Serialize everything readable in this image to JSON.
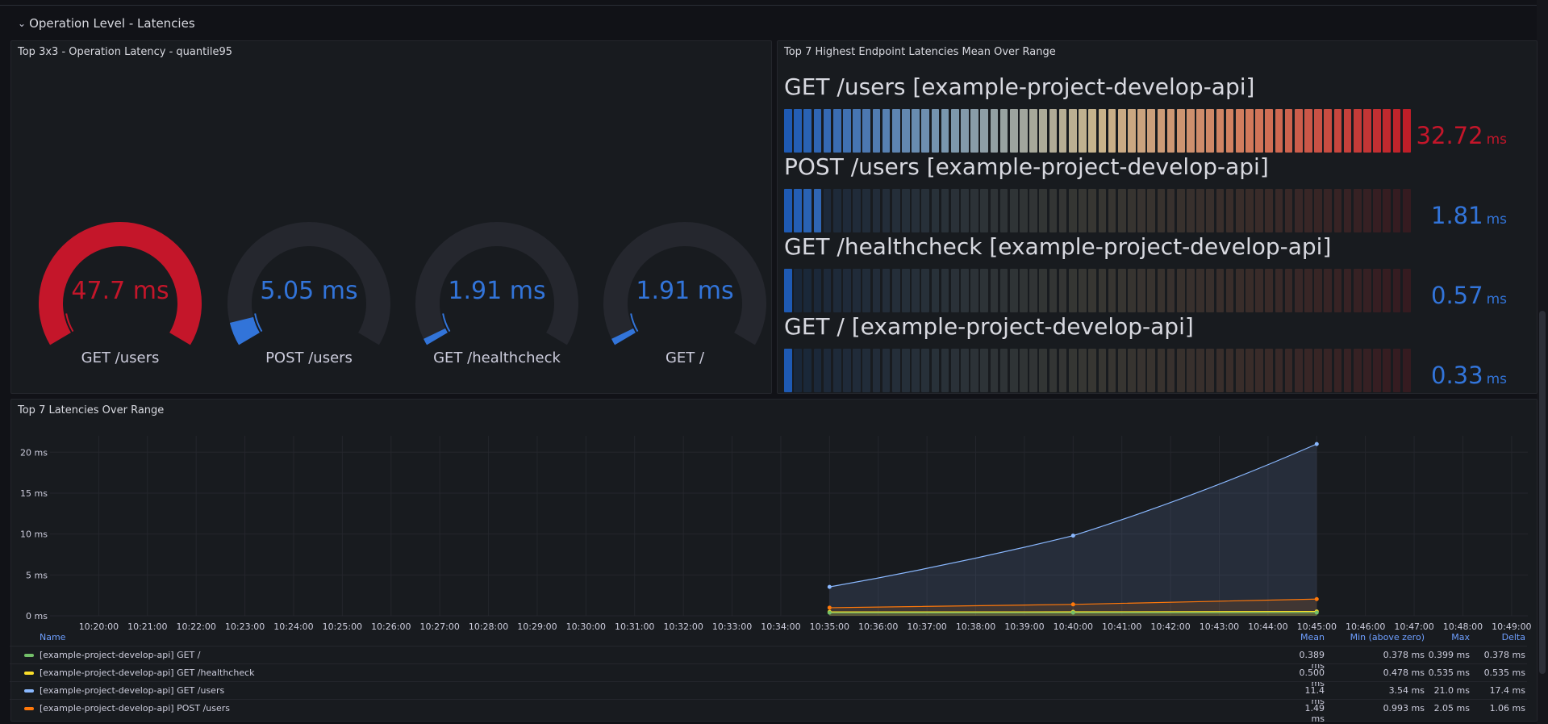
{
  "row": {
    "chevron": "⌄",
    "title": "Operation Level - Latencies"
  },
  "gauge_panel": {
    "title": "Top 3x3 - Operation Latency - quantile95",
    "gauges": [
      {
        "value": "47.7 ms",
        "label": "GET /users",
        "fraction": 1.0,
        "color": "#c4162a"
      },
      {
        "value": "5.05 ms",
        "label": "POST /users",
        "fraction": 0.07,
        "color": "#3274d9"
      },
      {
        "value": "1.91 ms",
        "label": "GET /healthcheck",
        "fraction": 0.02,
        "color": "#3274d9"
      },
      {
        "value": "1.91 ms",
        "label": "GET /",
        "fraction": 0.02,
        "color": "#3274d9"
      }
    ]
  },
  "bar_panel": {
    "title": "Top 7 Highest Endpoint Latencies Mean Over Range",
    "rows": [
      {
        "label": "GET /users [example-project-develop-api]",
        "value": "32.72",
        "unit": "ms",
        "fraction": 1.0,
        "color": "#c4162a"
      },
      {
        "label": "POST /users [example-project-develop-api]",
        "value": "1.81",
        "unit": "ms",
        "fraction": 0.055,
        "color": "#3274d9"
      },
      {
        "label": "GET /healthcheck [example-project-develop-api]",
        "value": "0.57",
        "unit": "ms",
        "fraction": 0.017,
        "color": "#3274d9"
      },
      {
        "label": "GET / [example-project-develop-api]",
        "value": "0.33",
        "unit": "ms",
        "fraction": 0.01,
        "color": "#3274d9"
      }
    ]
  },
  "timeseries": {
    "title": "Top 7 Latencies Over Range",
    "legend_headers": {
      "name": "Name",
      "mean": "Mean",
      "min": "Min (above zero)",
      "max": "Max",
      "delta": "Delta"
    },
    "legend": [
      {
        "name": "[example-project-develop-api] GET /",
        "color": "#73bf69",
        "mean": "0.389 ms",
        "min": "0.378 ms",
        "max": "0.399 ms",
        "delta": "0.378 ms"
      },
      {
        "name": "[example-project-develop-api] GET /healthcheck",
        "color": "#fade2a",
        "mean": "0.500 ms",
        "min": "0.478 ms",
        "max": "0.535 ms",
        "delta": "0.535 ms"
      },
      {
        "name": "[example-project-develop-api] GET /users",
        "color": "#8ab8ff",
        "mean": "11.4 ms",
        "min": "3.54 ms",
        "max": "21.0 ms",
        "delta": "17.4 ms"
      },
      {
        "name": "[example-project-develop-api] POST /users",
        "color": "#ff780a",
        "mean": "1.49 ms",
        "min": "0.993 ms",
        "max": "2.05 ms",
        "delta": "1.06 ms"
      }
    ]
  },
  "chart_data": {
    "type": "area",
    "title": "Top 7 Latencies Over Range",
    "x_ticks": [
      "10:20:00",
      "10:21:00",
      "10:22:00",
      "10:23:00",
      "10:24:00",
      "10:25:00",
      "10:26:00",
      "10:27:00",
      "10:28:00",
      "10:29:00",
      "10:30:00",
      "10:31:00",
      "10:32:00",
      "10:33:00",
      "10:34:00",
      "10:35:00",
      "10:36:00",
      "10:37:00",
      "10:38:00",
      "10:39:00",
      "10:40:00",
      "10:41:00",
      "10:42:00",
      "10:43:00",
      "10:44:00",
      "10:45:00",
      "10:46:00",
      "10:47:00",
      "10:48:00",
      "10:49:00"
    ],
    "y_ticks": [
      "0 ms",
      "5 ms",
      "10 ms",
      "15 ms",
      "20 ms"
    ],
    "ylim": [
      0,
      22
    ],
    "xlim": [
      "10:19:00",
      "10:49:20"
    ],
    "x": [
      "10:35:00",
      "10:40:00",
      "10:45:00"
    ],
    "series": [
      {
        "name": "[example-project-develop-api] GET /",
        "color": "#73bf69",
        "values": [
          0.378,
          0.39,
          0.399
        ]
      },
      {
        "name": "[example-project-develop-api] GET /healthcheck",
        "color": "#fade2a",
        "values": [
          0.478,
          0.49,
          0.535
        ]
      },
      {
        "name": "[example-project-develop-api] GET /users",
        "color": "#8ab8ff",
        "values": [
          3.54,
          9.8,
          21.0
        ]
      },
      {
        "name": "[example-project-develop-api] POST /users",
        "color": "#ff780a",
        "values": [
          0.993,
          1.4,
          2.05
        ]
      }
    ],
    "grid": true,
    "legend": "bottom"
  }
}
